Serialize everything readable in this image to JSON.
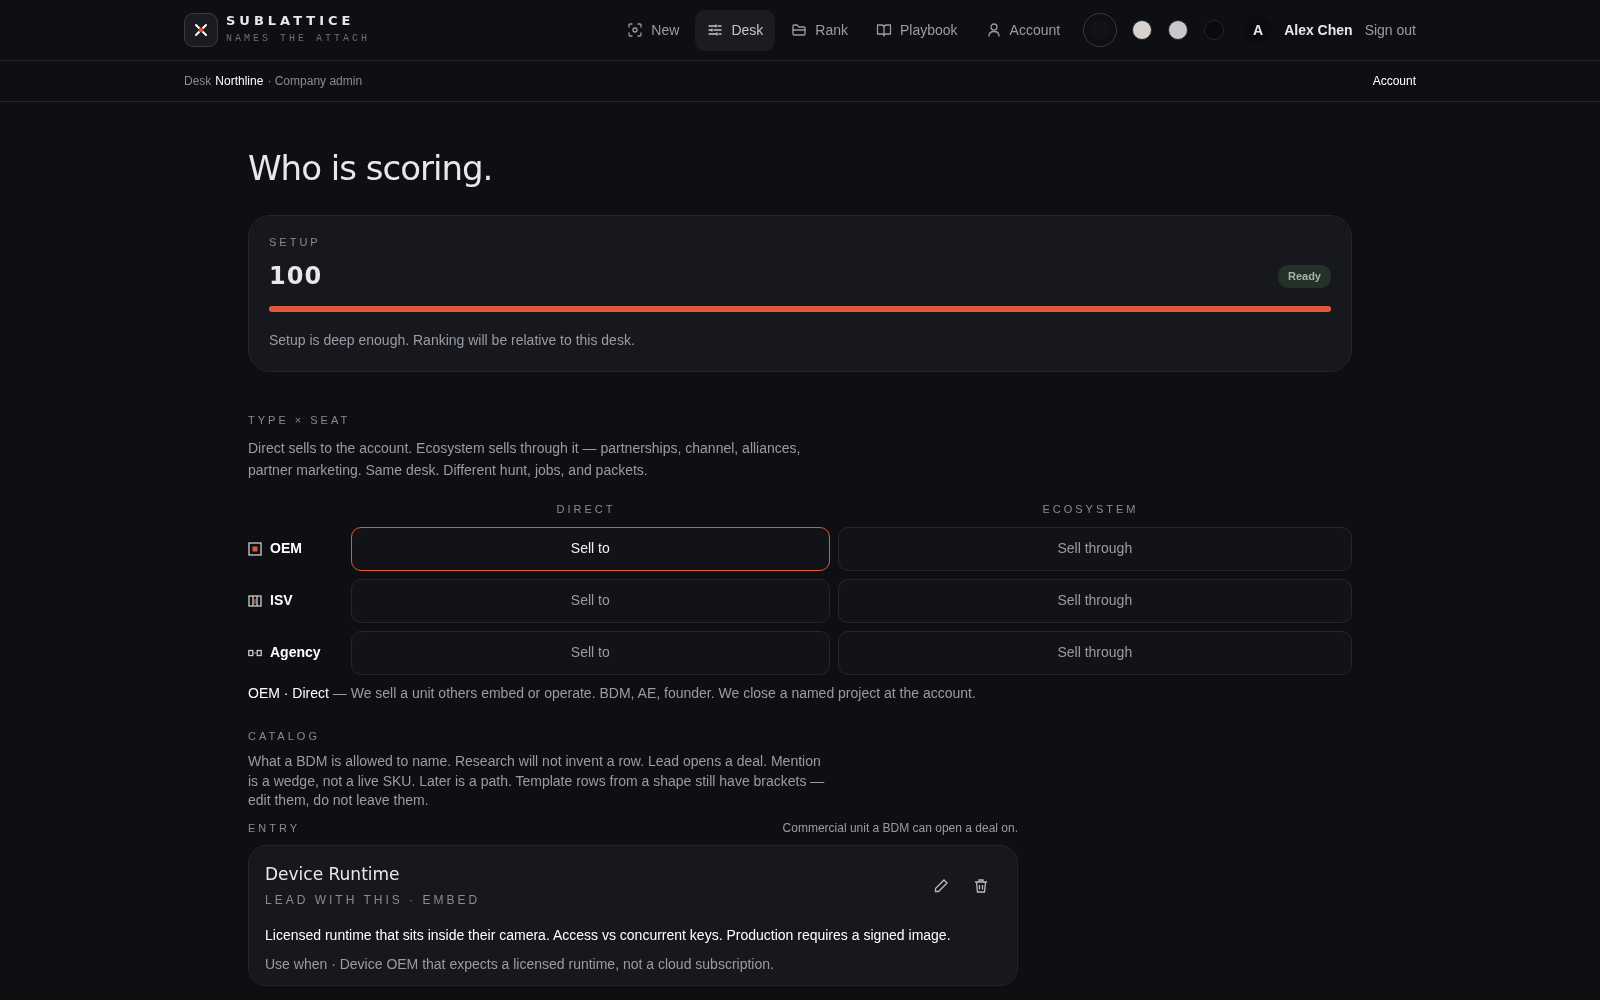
{
  "brand": {
    "name": "SUBLATTICE",
    "tagline": "NAMES THE ATTACH"
  },
  "nav": [
    {
      "label": "New",
      "selected": false
    },
    {
      "label": "Desk",
      "selected": true
    },
    {
      "label": "Rank",
      "selected": false
    },
    {
      "label": "Playbook",
      "selected": false
    },
    {
      "label": "Account",
      "selected": false
    }
  ],
  "themes": [
    {
      "color": "#121317",
      "selected": true
    },
    {
      "color": "#d6d3cf",
      "selected": false
    },
    {
      "color": "#c8c8cc",
      "selected": false
    },
    {
      "color": "#0a0a0d",
      "selected": false
    }
  ],
  "user": {
    "initial": "A",
    "name": "Alex Chen",
    "sign_out": "Sign out"
  },
  "subbar": {
    "prefix": "Desk",
    "desk": "Northline",
    "role": "· Company admin",
    "link": "Account"
  },
  "title": "Who is scoring.",
  "setup": {
    "label": "SETUP",
    "score": "100",
    "status": "Ready",
    "level": 1.0,
    "note": "Setup is deep enough. Ranking will be relative to this desk."
  },
  "type_seat": {
    "heading": "TYPE × SEAT",
    "intro": "Direct sells to the account. Ecosystem sells through it — partnerships, channel, alliances, partner marketing. Same desk. Different hunt, jobs, and packets.",
    "columns": [
      "DIRECT",
      "ECOSYSTEM"
    ],
    "rows": [
      {
        "label": "OEM",
        "kind": "oem",
        "cells": [
          {
            "label": "Sell to",
            "selected": true
          },
          {
            "label": "Sell through",
            "selected": false
          }
        ]
      },
      {
        "label": "ISV",
        "kind": "isv",
        "cells": [
          {
            "label": "Sell to",
            "selected": false
          },
          {
            "label": "Sell through",
            "selected": false
          }
        ]
      },
      {
        "label": "Agency",
        "kind": "agency",
        "cells": [
          {
            "label": "Sell to",
            "selected": false
          },
          {
            "label": "Sell through",
            "selected": false
          }
        ]
      }
    ],
    "selection": "OEM · Direct",
    "description": "— We sell a unit others embed or operate. BDM, AE, founder. We close a named project at the account."
  },
  "catalog": {
    "heading": "CATALOG",
    "intro": "What a BDM is allowed to name. Research will not invent a row. Lead opens a deal. Mention is a wedge, not a live SKU. Later is a path. Template rows from a shape still have brackets — edit them, do not leave them.",
    "entry_label": "ENTRY",
    "entry_hint": "Commercial unit a BDM can open a deal on.",
    "entries": [
      {
        "name": "Device Runtime",
        "meta": "LEAD WITH THIS · EMBED",
        "summary": "Licensed runtime that sits inside their camera. Access vs concurrent keys. Production requires a signed image.",
        "use_when": "Use when · Device OEM that expects a licensed runtime, not a cloud subscription."
      }
    ]
  }
}
